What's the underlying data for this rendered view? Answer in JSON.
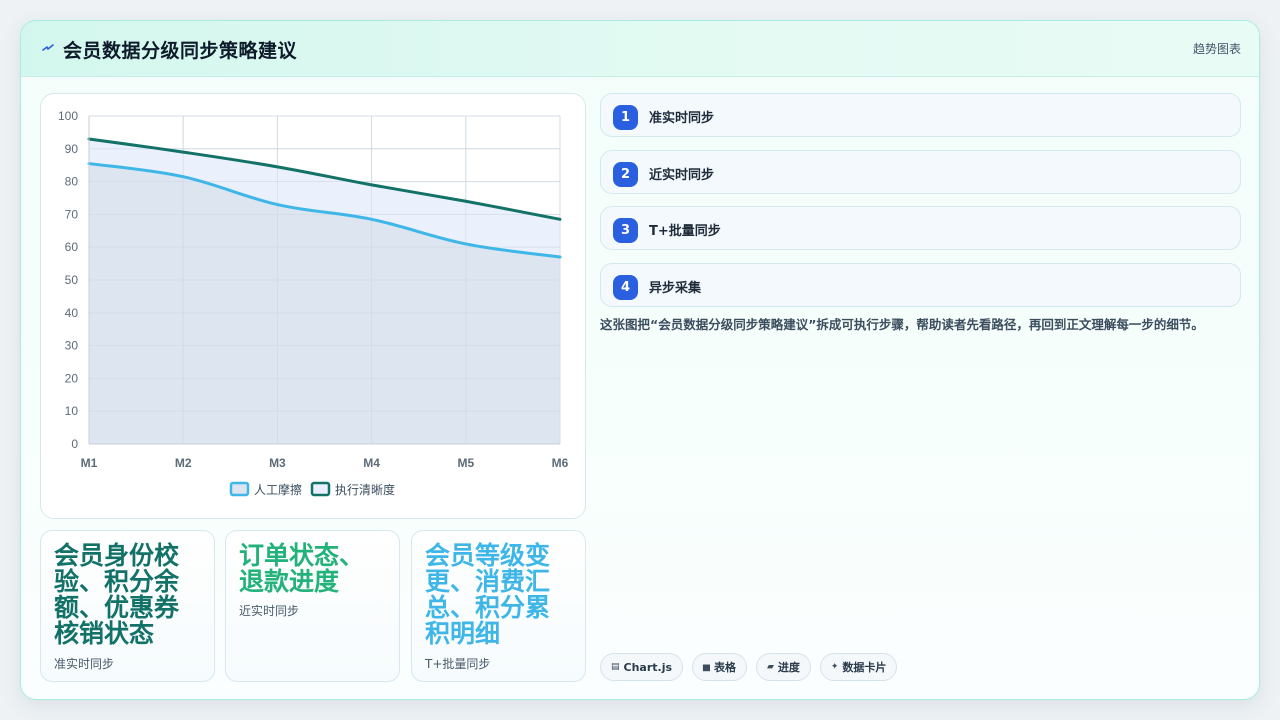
{
  "header": {
    "icon": "bolt-icon",
    "title": "会员数据分级同步策略建议",
    "tag": "趋势图表"
  },
  "chart_data": {
    "type": "area",
    "categories": [
      "M1",
      "M2",
      "M3",
      "M4",
      "M5",
      "M6"
    ],
    "ylim": [
      0,
      100
    ],
    "yticks": [
      0,
      10,
      20,
      30,
      40,
      50,
      60,
      70,
      80,
      90,
      100
    ],
    "grid": true,
    "legend_position": "bottom",
    "series": [
      {
        "name": "人工摩擦",
        "values": [
          85.5,
          81.5,
          73,
          68.5,
          61,
          57
        ],
        "color": "#3fb6e8",
        "fill": "#dce4ef"
      },
      {
        "name": "执行清晰度",
        "values": [
          93,
          89,
          84.5,
          79,
          74,
          68.5
        ],
        "color": "#137268",
        "fill": "#e9effc"
      }
    ]
  },
  "metrics": [
    {
      "value": "会员身份校验、积分余额、优惠券核销状态",
      "label": "准实时同步",
      "color": "#137268"
    },
    {
      "value": "订单状态、退款进度",
      "label": "近实时同步",
      "color": "#22b27a"
    },
    {
      "value": "会员等级变更、消费汇总、积分累积明细",
      "label": "T+批量同步",
      "color": "#3fb6e8"
    }
  ],
  "steps": [
    {
      "num": "1",
      "label": "准实时同步"
    },
    {
      "num": "2",
      "label": "近实时同步"
    },
    {
      "num": "3",
      "label": "T+批量同步"
    },
    {
      "num": "4",
      "label": "异步采集"
    }
  ],
  "description": "这张图把“会员数据分级同步策略建议”拆成可执行步骤，帮助读者先看路径，再回到正文理解每一步的细节。",
  "tags": [
    {
      "icon": "chart-icon",
      "glyph": "▤",
      "label": "Chart.js"
    },
    {
      "icon": "table-icon",
      "glyph": "▅",
      "label": "表格"
    },
    {
      "icon": "progress-icon",
      "glyph": "▰",
      "label": "进度"
    },
    {
      "icon": "sparkle-icon",
      "glyph": "✦",
      "label": "数据卡片"
    }
  ]
}
